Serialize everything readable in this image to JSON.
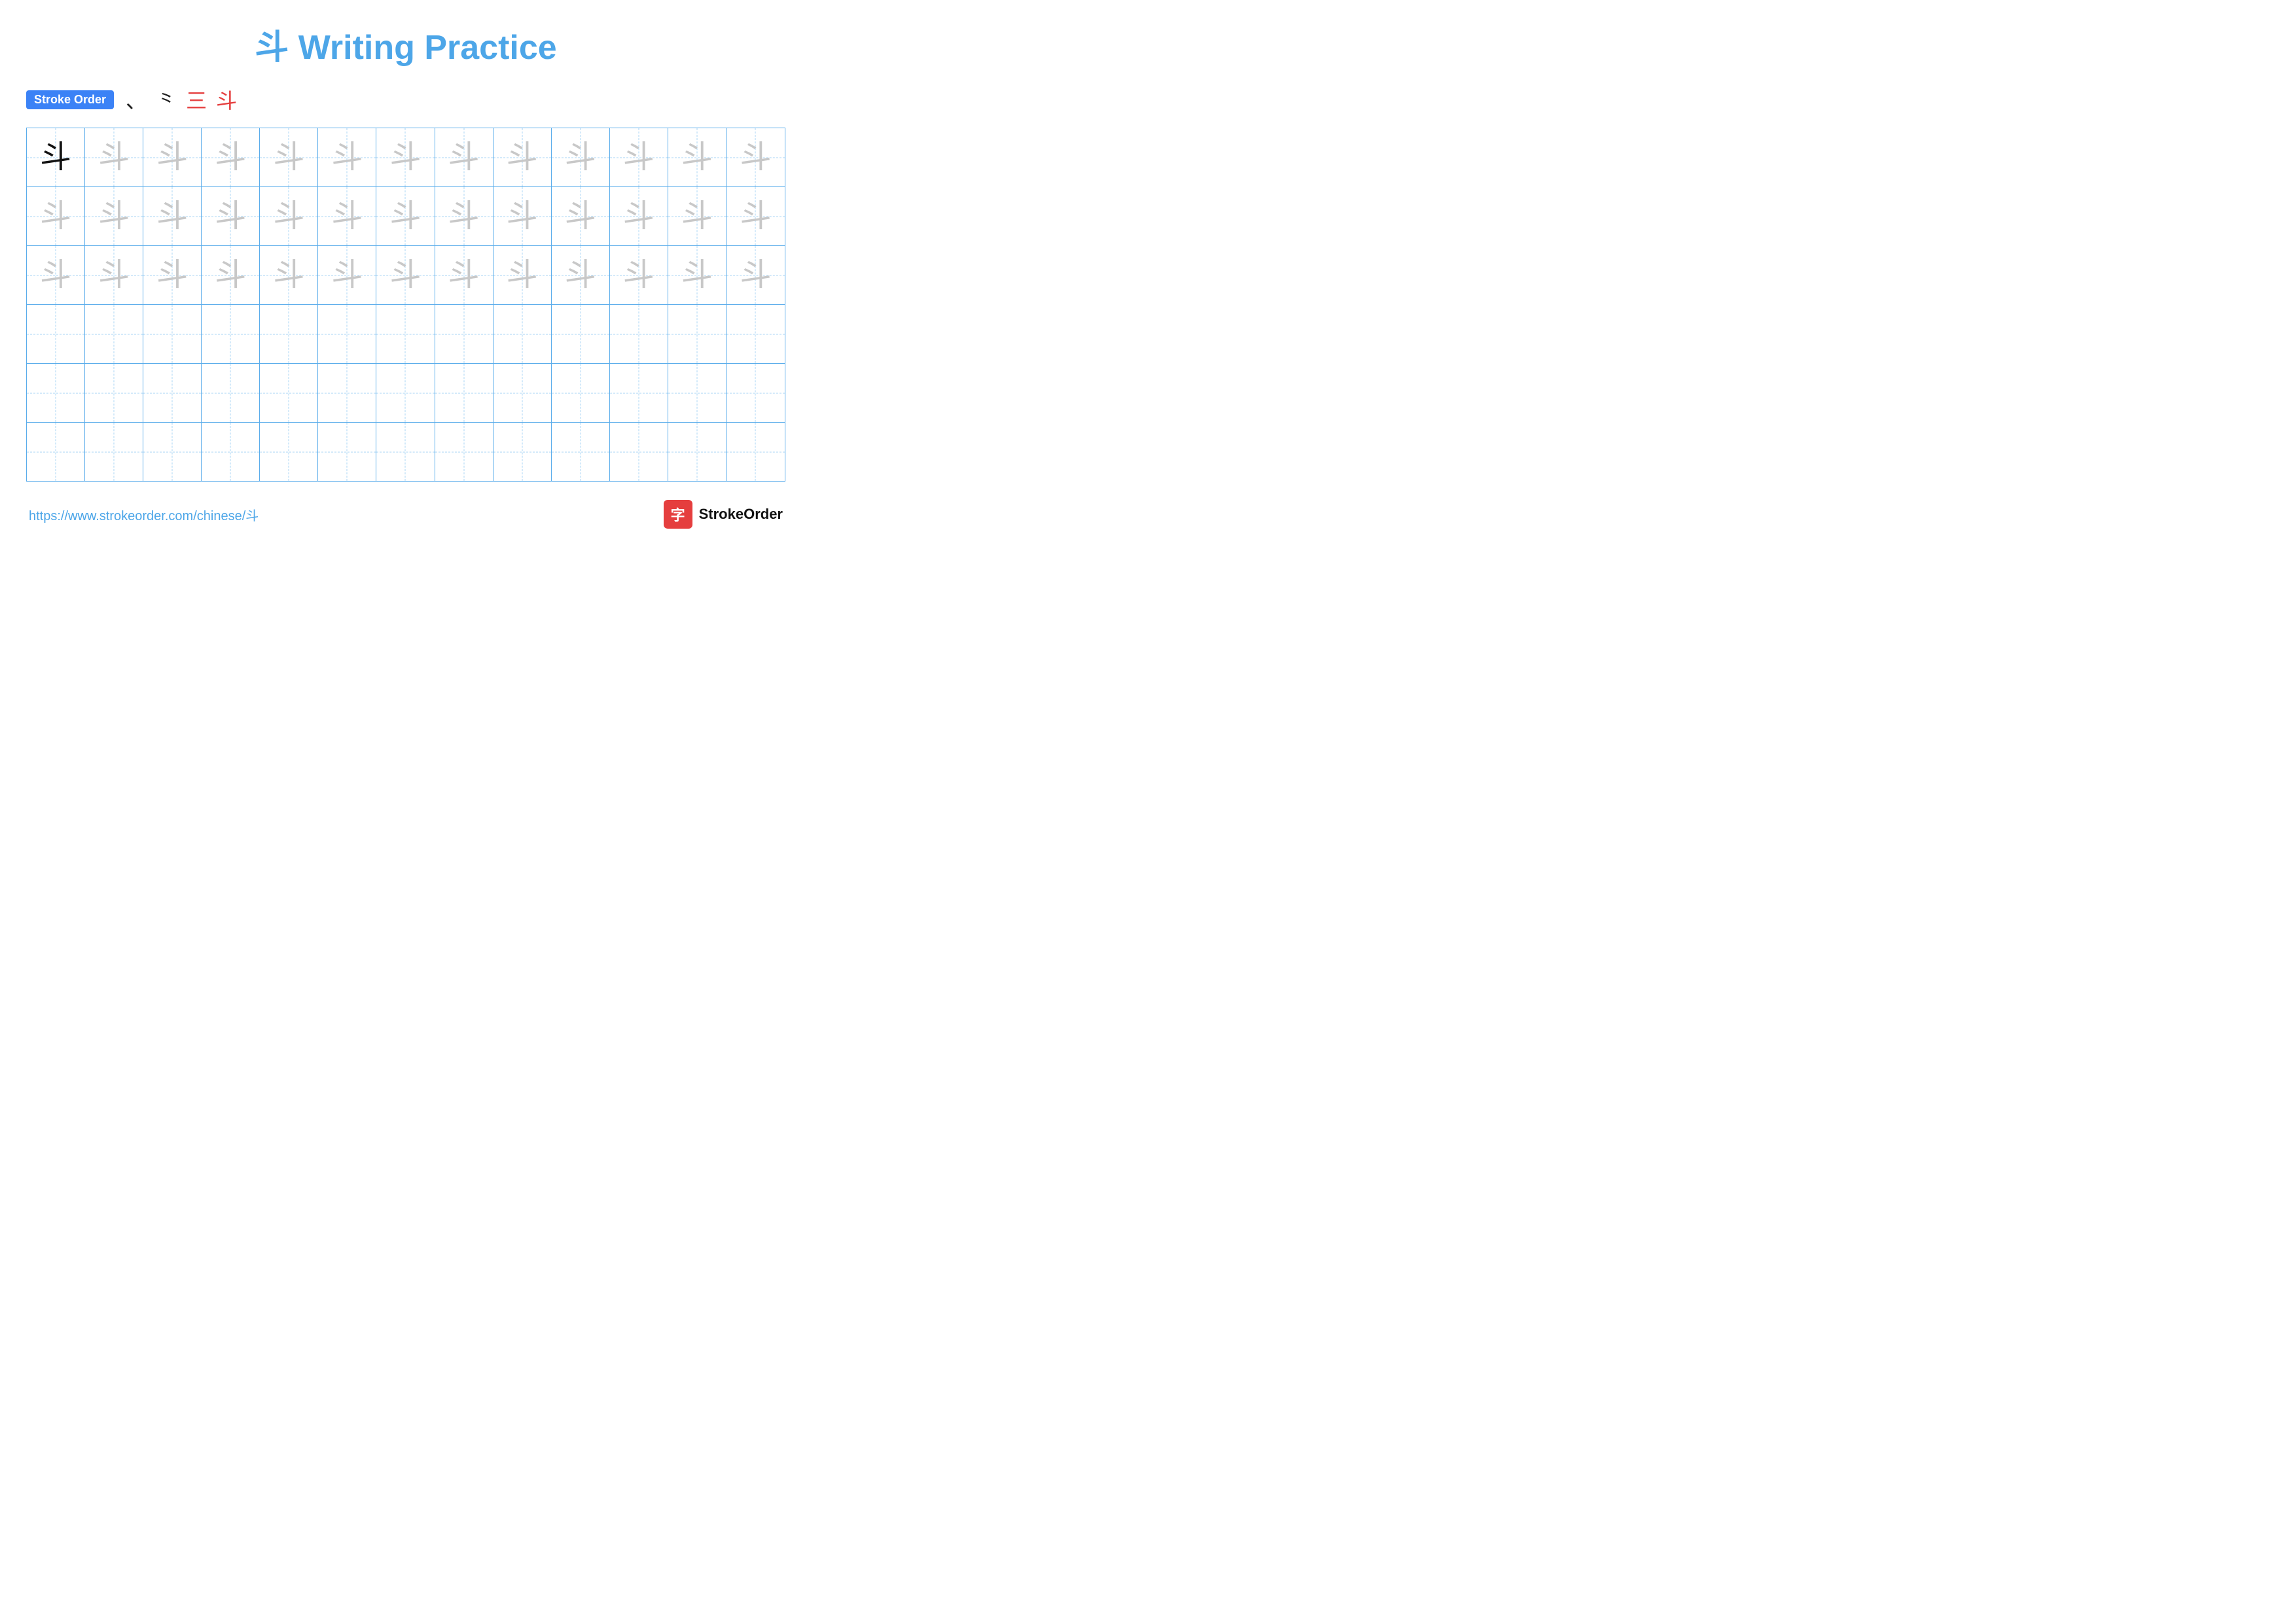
{
  "title": {
    "char": "斗",
    "text": "Writing Practice"
  },
  "stroke_order": {
    "badge_label": "Stroke Order",
    "strokes": [
      "、",
      "⺀",
      "三",
      "斗"
    ]
  },
  "grid": {
    "rows": 6,
    "cols": 13,
    "char": "斗",
    "filled_rows": 3,
    "empty_rows": 3
  },
  "footer": {
    "url": "https://www.strokeorder.com/chinese/斗",
    "brand": "StrokeOrder",
    "brand_icon": "字"
  }
}
